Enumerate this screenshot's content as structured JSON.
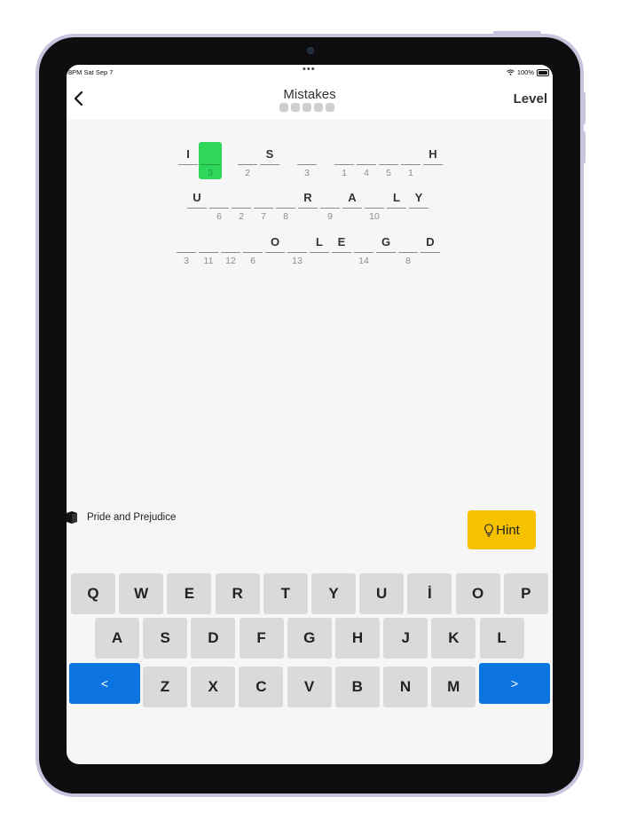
{
  "status": {
    "time": "8PM  Sat Sep 7",
    "dots": "•••",
    "battery": "100%"
  },
  "header": {
    "title": "Mistakes",
    "mistakes_total": 5,
    "mistakes_used": 0,
    "level_label": "Level"
  },
  "puzzle": {
    "rows": [
      [
        {
          "letter": "I",
          "num": ""
        },
        {
          "letter": "",
          "num": "3",
          "selected": true
        },
        {
          "gap": true
        },
        {
          "letter": "",
          "num": "2"
        },
        {
          "letter": "S",
          "num": ""
        },
        {
          "gap": true
        },
        {
          "letter": "",
          "num": "3"
        },
        {
          "gap": true
        },
        {
          "letter": "",
          "num": "1"
        },
        {
          "letter": "",
          "num": "4"
        },
        {
          "letter": "",
          "num": "5"
        },
        {
          "letter": "",
          "num": "1"
        },
        {
          "letter": "H",
          "num": ""
        }
      ],
      [
        {
          "letter": "U",
          "num": ""
        },
        {
          "letter": "",
          "num": "6"
        },
        {
          "letter": "",
          "num": "2"
        },
        {
          "letter": "",
          "num": "7"
        },
        {
          "letter": "",
          "num": "8"
        },
        {
          "letter": "R",
          "num": ""
        },
        {
          "letter": "",
          "num": "9"
        },
        {
          "letter": "A",
          "num": ""
        },
        {
          "letter": "",
          "num": "10"
        },
        {
          "letter": "L",
          "num": ""
        },
        {
          "letter": "Y",
          "num": ""
        }
      ],
      [
        {
          "letter": "",
          "num": "3"
        },
        {
          "letter": "",
          "num": "11"
        },
        {
          "letter": "",
          "num": "12"
        },
        {
          "letter": "",
          "num": "6"
        },
        {
          "letter": "O",
          "num": ""
        },
        {
          "letter": "",
          "num": "13"
        },
        {
          "letter": "L",
          "num": ""
        },
        {
          "letter": "E",
          "num": ""
        },
        {
          "letter": "",
          "num": "14"
        },
        {
          "letter": "G",
          "num": ""
        },
        {
          "letter": "",
          "num": "8"
        },
        {
          "letter": "D",
          "num": ""
        }
      ]
    ]
  },
  "source": {
    "title": "Pride and Prejudice"
  },
  "hint": {
    "label": "Hint"
  },
  "keyboard": {
    "row1": [
      "Q",
      "W",
      "E",
      "R",
      "T",
      "Y",
      "U",
      "İ",
      "O",
      "P"
    ],
    "row2": [
      "A",
      "S",
      "D",
      "F",
      "G",
      "H",
      "J",
      "K",
      "L"
    ],
    "row3": [
      "Z",
      "X",
      "C",
      "V",
      "B",
      "N",
      "M"
    ],
    "prev_label": "<",
    "next_label": ">"
  },
  "colors": {
    "selected": "#2ed65a",
    "hint": "#f6c200",
    "nav": "#0b74e0",
    "key": "#dadada"
  }
}
